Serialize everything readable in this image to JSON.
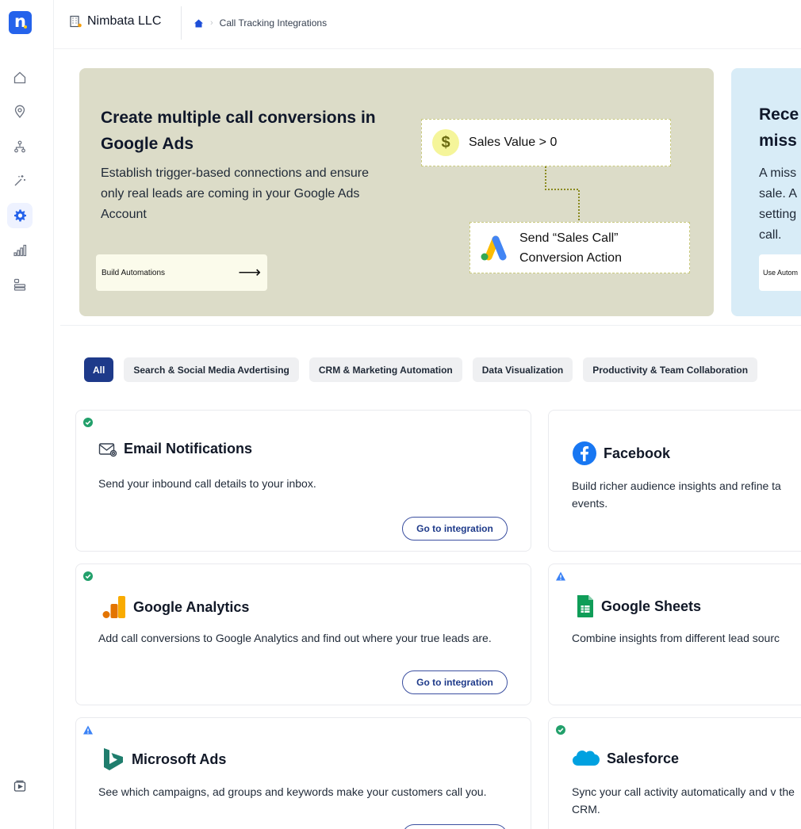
{
  "sidebar": {
    "logo_text": "n",
    "items": [
      {
        "icon": "home-icon"
      },
      {
        "icon": "location-pin-icon"
      },
      {
        "icon": "hierarchy-icon"
      },
      {
        "icon": "magic-wand-icon"
      },
      {
        "icon": "gear-icon",
        "active": true
      },
      {
        "icon": "bar-chart-icon"
      },
      {
        "icon": "server-icon"
      }
    ],
    "bottom_icon": "video-play-icon"
  },
  "header": {
    "company": "Nimbata LLC",
    "breadcrumb": [
      "Call Tracking Integrations"
    ]
  },
  "banners": [
    {
      "title": "Create multiple call conversions in Google Ads",
      "description": "Establish trigger-based connections and ensure only real leads are coming in your Google Ads Account",
      "button": "Build Automations",
      "flow_top": "Sales Value > 0",
      "flow_bottom_line1": "Send “Sales Call”",
      "flow_bottom_line2": "Conversion Action",
      "dollar": "$"
    },
    {
      "title_line1": "Rece",
      "title_line2": "miss",
      "description_lines": [
        "A miss",
        "sale. A",
        "setting",
        "call."
      ],
      "button": "Use Autom"
    }
  ],
  "filters": [
    {
      "label": "All",
      "active": true
    },
    {
      "label": "Search & Social Media Avdertising"
    },
    {
      "label": "CRM & Marketing Automation"
    },
    {
      "label": "Data Visualization"
    },
    {
      "label": "Productivity & Team Collaboration"
    }
  ],
  "cards": [
    {
      "title": "Email Notifications",
      "description": "Send your inbound call details to your inbox.",
      "button": "Go to integration",
      "status": "success",
      "icon": "email-icon"
    },
    {
      "title": "Facebook",
      "description": "Build richer audience insights and refine ta events.",
      "status": "none",
      "icon": "facebook-icon"
    },
    {
      "title": "Google Analytics",
      "description": "Add call conversions to Google Analytics and find out where your true leads are.",
      "button": "Go to integration",
      "status": "success",
      "icon": "google-analytics-icon"
    },
    {
      "title": "Google Sheets",
      "description": "Combine insights from different lead sourc",
      "status": "warning",
      "icon": "google-sheets-icon"
    },
    {
      "title": "Microsoft Ads",
      "description": "See which campaigns, ad groups and keywords make your customers call you.",
      "status": "warning",
      "icon": "microsoft-ads-icon"
    },
    {
      "title": "Salesforce",
      "description": "Sync your call activity automatically and v the CRM.",
      "status": "success",
      "icon": "salesforce-icon"
    }
  ],
  "colors": {
    "brand": "#2563eb",
    "active_chip": "#1e3a8a",
    "banner1_bg": "#dcdcc8",
    "banner2_bg": "#d8ecf7",
    "success": "#22a06b",
    "warning": "#3b82f6"
  }
}
